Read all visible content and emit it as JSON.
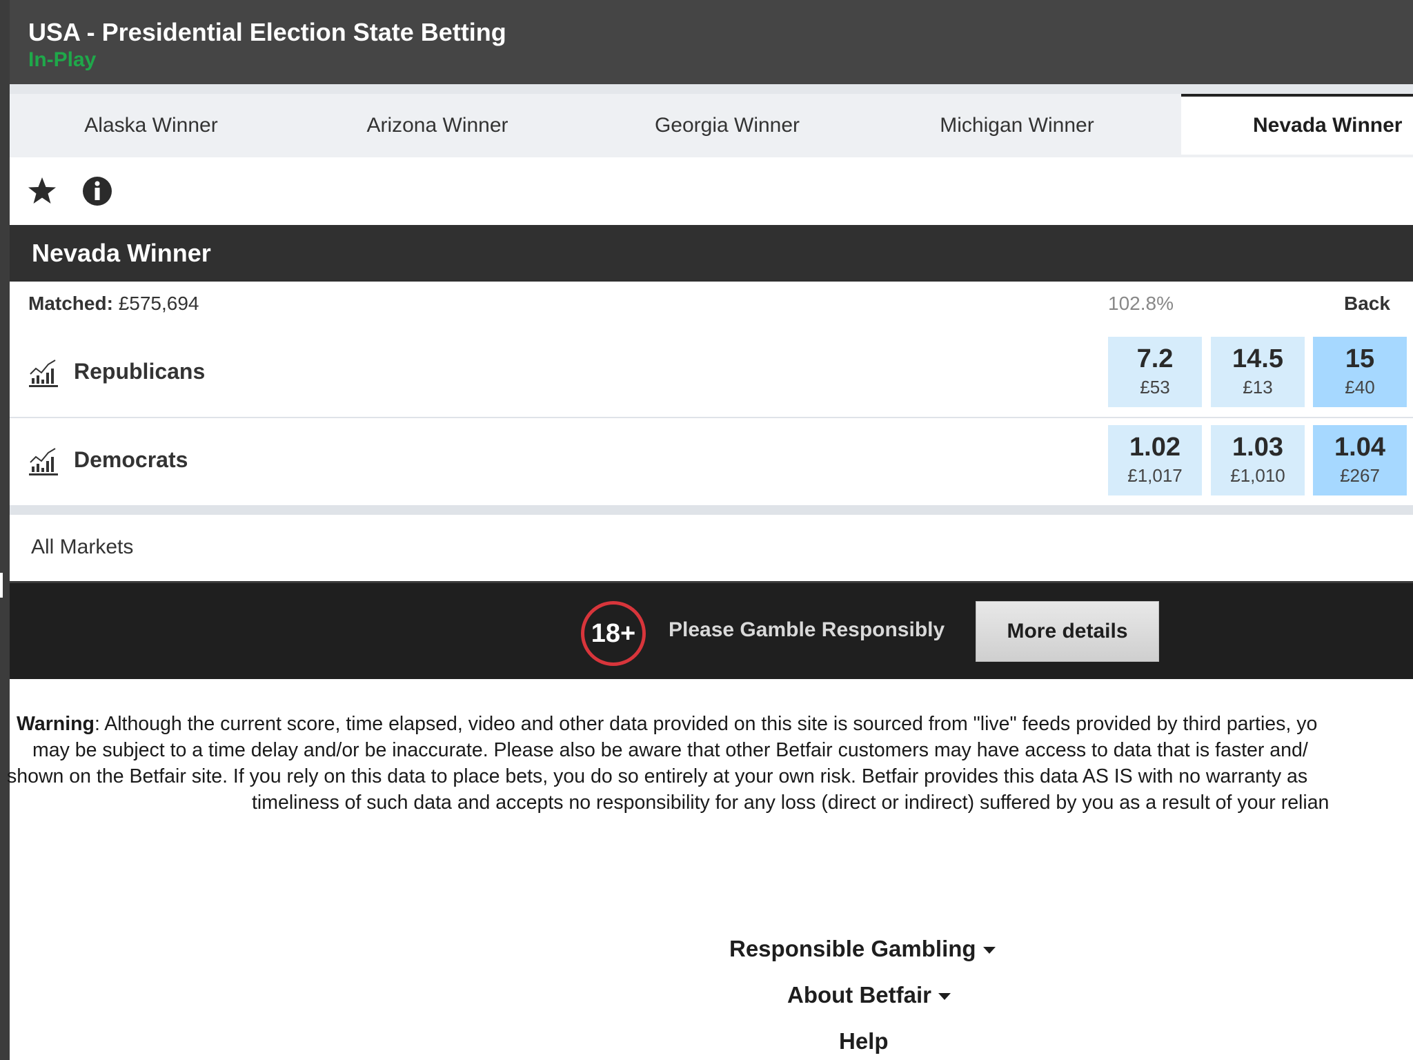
{
  "header": {
    "title": "USA - Presidential Election State Betting",
    "status": "In-Play"
  },
  "tabs": [
    {
      "label": "Alaska Winner",
      "active": false
    },
    {
      "label": "Arizona Winner",
      "active": false
    },
    {
      "label": "Georgia Winner",
      "active": false
    },
    {
      "label": "Michigan Winner",
      "active": false
    },
    {
      "label": "Nevada Winner",
      "active": true
    }
  ],
  "toolbar": {
    "icons": [
      "star-icon",
      "info-icon"
    ]
  },
  "market": {
    "title": "Nevada Winner",
    "matched_label": "Matched:",
    "matched_value": "£575,694",
    "book_percentage": "102.8%",
    "back_label": "Back",
    "runners": [
      {
        "name": "Republicans",
        "prices": [
          {
            "odds": "7.2",
            "stake": "£53"
          },
          {
            "odds": "14.5",
            "stake": "£13"
          },
          {
            "odds": "15",
            "stake": "£40"
          }
        ]
      },
      {
        "name": "Democrats",
        "prices": [
          {
            "odds": "1.02",
            "stake": "£1,017"
          },
          {
            "odds": "1.03",
            "stake": "£1,010"
          },
          {
            "odds": "1.04",
            "stake": "£267"
          }
        ]
      }
    ],
    "all_markets_label": "All Markets"
  },
  "responsible_gambling": {
    "badge": "18+",
    "text": "Please Gamble Responsibly",
    "button_label": "More details"
  },
  "warning": {
    "label": "Warning",
    "line1": ": Although the current score, time elapsed, video and other data provided on this site is sourced from \"live\" feeds provided by third parties, yo",
    "line2": "may be subject to a time delay and/or be inaccurate.  Please also be aware that other Betfair customers may have access to data that is faster and/",
    "line3": "shown on the Betfair site. If you rely on this data to place bets, you do so entirely at your own risk. Betfair provides this data AS IS with no warranty as",
    "line4": "timeliness of such data and accepts no responsibility for any loss (direct or indirect) suffered by you as a result of your relian"
  },
  "footer": {
    "links": [
      {
        "label": "Responsible Gambling",
        "dropdown": true
      },
      {
        "label": "About Betfair",
        "dropdown": true
      },
      {
        "label": "Help",
        "dropdown": false
      }
    ]
  },
  "colors": {
    "header_bg": "#454545",
    "in_play_green": "#1fa84a",
    "back_price": "#d6ecfb",
    "back_price_best": "#a6d8ff",
    "market_bar": "#303030",
    "rg_ring": "#d8353b"
  }
}
